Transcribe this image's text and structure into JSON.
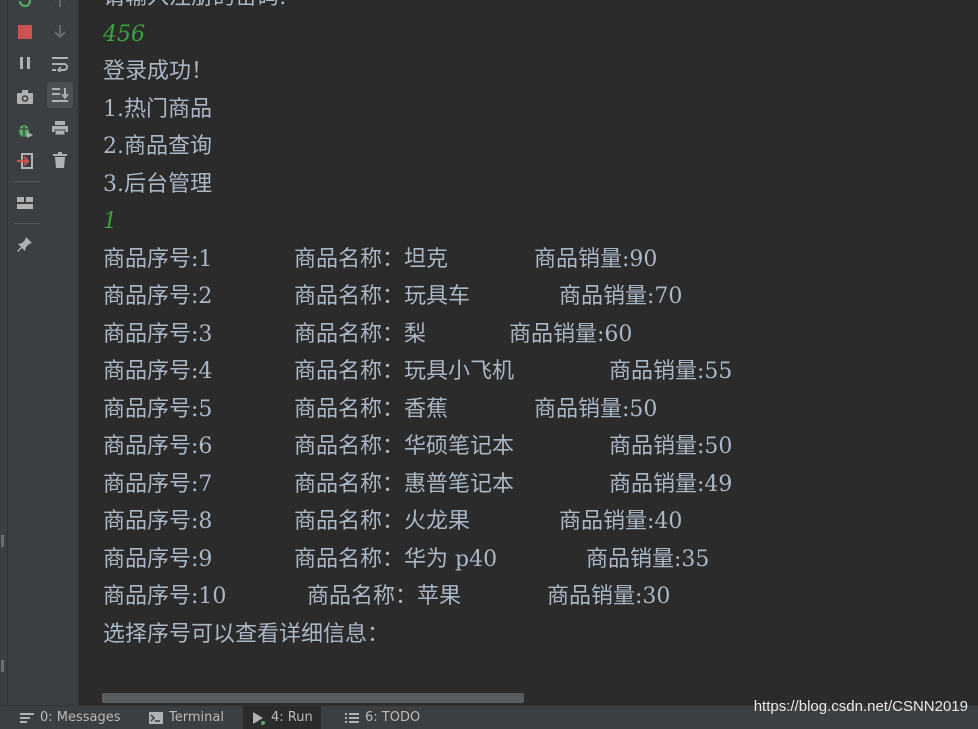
{
  "console": {
    "header_partial": "请输入注册的密码:",
    "lines": [
      {
        "text": "456",
        "kind": "input"
      },
      {
        "text": "登录成功！",
        "kind": "output"
      },
      {
        "text": "1.热门商品",
        "kind": "output"
      },
      {
        "text": "2.商品查询",
        "kind": "output"
      },
      {
        "text": "3.后台管理",
        "kind": "output"
      },
      {
        "text": "1",
        "kind": "input"
      }
    ],
    "products": [
      {
        "id": "商品序号:1",
        "name": "商品名称：坦克",
        "sales": "商品销量:90"
      },
      {
        "id": "商品序号:2",
        "name": "商品名称：玩具车",
        "sales": "商品销量:70"
      },
      {
        "id": "商品序号:3",
        "name": "商品名称：梨",
        "sales": "商品销量:60"
      },
      {
        "id": "商品序号:4",
        "name": "商品名称：玩具小飞机",
        "sales": "商品销量:55"
      },
      {
        "id": "商品序号:5",
        "name": "商品名称：香蕉",
        "sales": "商品销量:50"
      },
      {
        "id": "商品序号:6",
        "name": "商品名称：华硕笔记本",
        "sales": "商品销量:50"
      },
      {
        "id": "商品序号:7",
        "name": "商品名称：惠普笔记本",
        "sales": "商品销量:49"
      },
      {
        "id": "商品序号:8",
        "name": "商品名称：火龙果",
        "sales": "商品销量:40"
      },
      {
        "id": "商品序号:9",
        "name": "商品名称：华为 p40",
        "sales": "商品销量:35"
      },
      {
        "id": "商品序号:10",
        "name": "商品名称：苹果",
        "sales": "商品销量:30"
      }
    ],
    "footer_prompt": "选择序号可以查看详细信息："
  },
  "toolbar": {
    "left_icons": [
      "rerun-icon",
      "stop-icon",
      "pause-icon",
      "camera-icon",
      "debug-icon",
      "exit-icon",
      "layout-icon",
      "pin-icon"
    ],
    "right_icons": [
      "up-arrow-icon",
      "down-arrow-icon",
      "soft-wrap-icon",
      "scroll-to-end-icon",
      "print-icon",
      "trash-icon"
    ]
  },
  "statusbar": {
    "tabs": [
      {
        "label": "0: Messages",
        "icon": "messages-icon"
      },
      {
        "label": "Terminal",
        "icon": "terminal-icon"
      },
      {
        "label": "4: Run",
        "icon": "run-icon",
        "active": true
      },
      {
        "label": "6: TODO",
        "icon": "todo-icon"
      }
    ]
  },
  "watermark": "https://blog.csdn.net/CSNN2019",
  "colors": {
    "background": "#2b2b2b",
    "panel": "#3c3f41",
    "console_text": "#a9b7c6",
    "user_input": "#39a33d",
    "stop_red": "#c75450"
  }
}
